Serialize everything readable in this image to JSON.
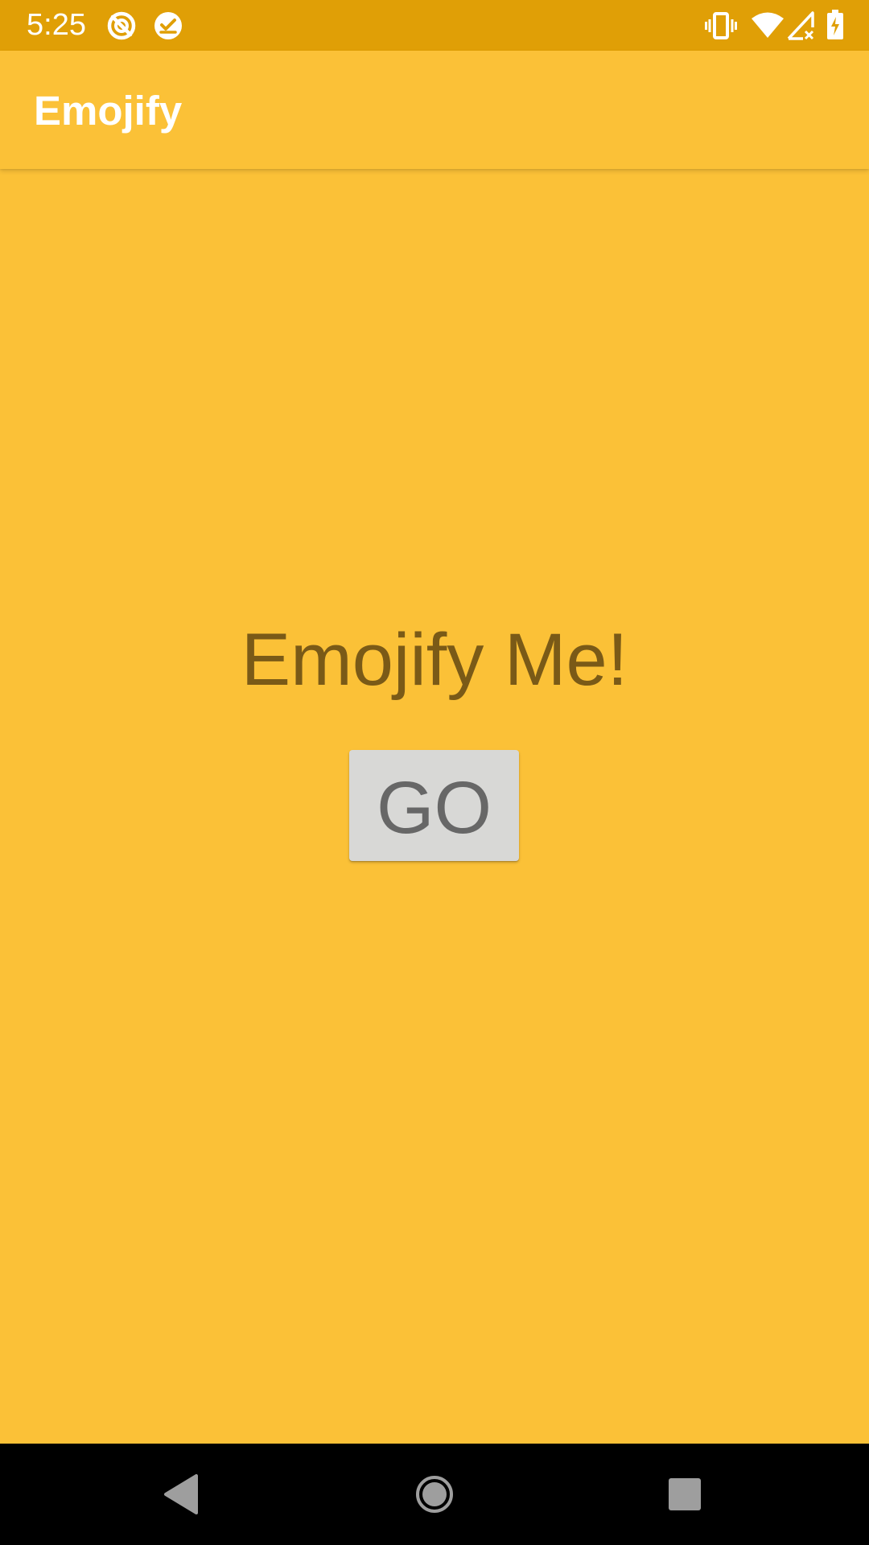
{
  "status_bar": {
    "time": "5:25",
    "left_icons": [
      "sync-disabled-icon",
      "check-circle-icon"
    ],
    "right_icons": [
      "vibrate-icon",
      "wifi-icon",
      "signal-no-data-icon",
      "battery-charging-icon"
    ]
  },
  "app_bar": {
    "title": "Emojify"
  },
  "main": {
    "headline": "Emojify Me!",
    "go_button_label": "GO"
  },
  "nav_bar": {
    "buttons": [
      "back-icon",
      "home-icon",
      "recents-icon"
    ]
  },
  "colors": {
    "status_bar": "#E09F06",
    "primary": "#FBC137",
    "headline_text": "#7A5A17",
    "button_bg": "#D8D8D6",
    "button_text": "#676767",
    "nav_bar": "#000000"
  }
}
